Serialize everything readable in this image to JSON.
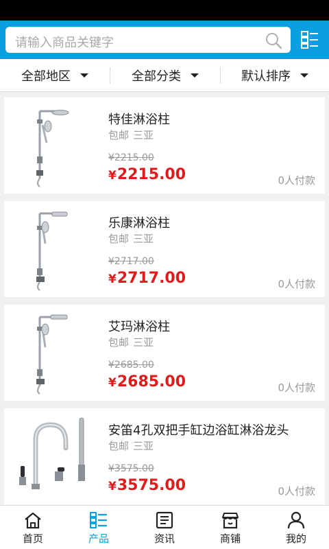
{
  "search": {
    "placeholder": "请输入商品关键字"
  },
  "filters": [
    {
      "label": "全部地区"
    },
    {
      "label": "全部分类"
    },
    {
      "label": "默认排序"
    }
  ],
  "currency_symbol": "¥",
  "products": [
    {
      "name": "特佳淋浴柱",
      "shipping": "包邮",
      "location": "三亚",
      "old_price": "¥2215.00",
      "price": "2215.00",
      "sold": "0人付款",
      "image": "shower-column"
    },
    {
      "name": "乐康淋浴柱",
      "shipping": "包邮",
      "location": "三亚",
      "old_price": "¥2717.00",
      "price": "2717.00",
      "sold": "0人付款",
      "image": "shower-column"
    },
    {
      "name": "艾玛淋浴柱",
      "shipping": "包邮",
      "location": "三亚",
      "old_price": "¥2685.00",
      "price": "2685.00",
      "sold": "0人付款",
      "image": "shower-column"
    },
    {
      "name": "安笛4孔双把手缸边浴缸淋浴龙头",
      "shipping": "包邮",
      "location": "三亚",
      "old_price": "¥3575.00",
      "price": "3575.00",
      "sold": "0人付款",
      "image": "bathtub-faucet-set"
    }
  ],
  "tabs": [
    {
      "label": "首页",
      "icon": "home-icon",
      "active": false
    },
    {
      "label": "产品",
      "icon": "product-list-icon",
      "active": true
    },
    {
      "label": "资讯",
      "icon": "news-icon",
      "active": false
    },
    {
      "label": "商铺",
      "icon": "shop-icon",
      "active": false
    },
    {
      "label": "我的",
      "icon": "user-icon",
      "active": false
    }
  ],
  "colors": {
    "accent": "#0a9fe0",
    "price": "#e01b1b",
    "muted": "#999999"
  }
}
